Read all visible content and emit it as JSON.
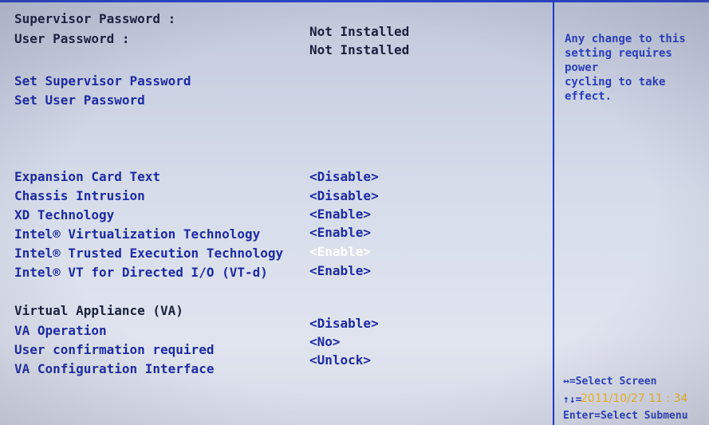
{
  "passwords": {
    "supervisor_label": "Supervisor Password :",
    "supervisor_value": "Not Installed",
    "user_label": "User Password :",
    "user_value": "Not Installed",
    "set_supervisor": "Set Supervisor Password",
    "set_user": "Set User Password"
  },
  "settings": [
    {
      "label": "Expansion Card Text",
      "value": "<Disable>"
    },
    {
      "label": "Chassis Intrusion",
      "value": "<Disable>"
    },
    {
      "label": "XD Technology",
      "value": "<Enable>"
    },
    {
      "label": "Intel® Virtualization Technology",
      "value": "<Enable>"
    },
    {
      "label": "Intel® Trusted Execution Technology",
      "value": "<Enable>"
    },
    {
      "label": "Intel® VT for Directed I/O (VT-d)",
      "value": "<Enable>"
    }
  ],
  "va": {
    "heading": "Virtual Appliance (VA)",
    "operation_label": "VA Operation",
    "operation_value": "<Disable>",
    "confirm_label": "User confirmation required",
    "confirm_value": "<No>",
    "config_label": "VA Configuration Interface",
    "config_value": "<Unlock>"
  },
  "help": {
    "text": "Any change to this\nsetting requires power\ncycling to take\neffect.",
    "key_select_screen": "↔=Select Screen",
    "key_select_item": "↑↓=",
    "key_enter": "Enter=Select Submenu"
  },
  "photo_stamp": "2011/10/27  11 : 34",
  "colors": {
    "accent": "#1d2ba3",
    "selected": "#ffffff",
    "stamp": "#f3b71b"
  }
}
